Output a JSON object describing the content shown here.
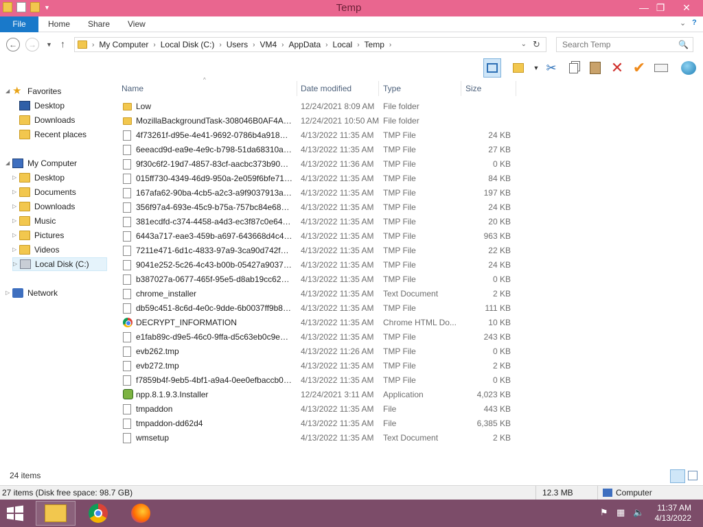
{
  "window": {
    "title": "Temp",
    "controls": {
      "minimize": "—",
      "maximize": "❐",
      "close": "✕"
    }
  },
  "ribbon": {
    "file_tab": "File",
    "tabs": [
      "Home",
      "Share",
      "View"
    ]
  },
  "address": {
    "breadcrumbs": [
      "My Computer",
      "Local Disk (C:)",
      "Users",
      "VM4",
      "AppData",
      "Local",
      "Temp"
    ]
  },
  "search": {
    "placeholder": "Search Temp"
  },
  "nav": {
    "favorites_header": "Favorites",
    "favorites": [
      "Desktop",
      "Downloads",
      "Recent places"
    ],
    "computer_header": "My Computer",
    "computer_items": [
      "Desktop",
      "Documents",
      "Downloads",
      "Music",
      "Pictures",
      "Videos",
      "Local Disk (C:)"
    ],
    "network": "Network"
  },
  "columns": {
    "name": "Name",
    "date": "Date modified",
    "type": "Type",
    "size": "Size"
  },
  "files": [
    {
      "icon": "folder",
      "name": "Low",
      "date": "12/24/2021 8:09 AM",
      "type": "File folder",
      "size": ""
    },
    {
      "icon": "folder",
      "name": "MozillaBackgroundTask-308046B0AF4A3...",
      "date": "12/24/2021 10:50 AM",
      "type": "File folder",
      "size": ""
    },
    {
      "icon": "doc",
      "name": "4f73261f-d95e-4e41-9692-0786b4a9181e.t...",
      "date": "4/13/2022 11:35 AM",
      "type": "TMP File",
      "size": "24 KB"
    },
    {
      "icon": "doc",
      "name": "6eeacd9d-ea9e-4e9c-b798-51da68310a9b...",
      "date": "4/13/2022 11:35 AM",
      "type": "TMP File",
      "size": "27 KB"
    },
    {
      "icon": "doc",
      "name": "9f30c6f2-19d7-4857-83cf-aacbc373b90c.t...",
      "date": "4/13/2022 11:36 AM",
      "type": "TMP File",
      "size": "0 KB"
    },
    {
      "icon": "doc",
      "name": "015ff730-4349-46d9-950a-2e059f6bfe71.t...",
      "date": "4/13/2022 11:35 AM",
      "type": "TMP File",
      "size": "84 KB"
    },
    {
      "icon": "doc",
      "name": "167afa62-90ba-4cb5-a2c3-a9f9037913af.t...",
      "date": "4/13/2022 11:35 AM",
      "type": "TMP File",
      "size": "197 KB"
    },
    {
      "icon": "doc",
      "name": "356f97a4-693e-45c9-b75a-757bc84e686e....",
      "date": "4/13/2022 11:35 AM",
      "type": "TMP File",
      "size": "24 KB"
    },
    {
      "icon": "doc",
      "name": "381ecdfd-c374-4458-a4d3-ec3f87c0e642....",
      "date": "4/13/2022 11:35 AM",
      "type": "TMP File",
      "size": "20 KB"
    },
    {
      "icon": "doc",
      "name": "6443a717-eae3-459b-a697-643668d4c4d2...",
      "date": "4/13/2022 11:35 AM",
      "type": "TMP File",
      "size": "963 KB"
    },
    {
      "icon": "doc",
      "name": "7211e471-6d1c-4833-97a9-3ca90d742f8d....",
      "date": "4/13/2022 11:35 AM",
      "type": "TMP File",
      "size": "22 KB"
    },
    {
      "icon": "doc",
      "name": "9041e252-5c26-4c43-b00b-05427a903759....",
      "date": "4/13/2022 11:35 AM",
      "type": "TMP File",
      "size": "24 KB"
    },
    {
      "icon": "doc",
      "name": "b387027a-0677-465f-95e5-d8ab19cc62ad....",
      "date": "4/13/2022 11:35 AM",
      "type": "TMP File",
      "size": "0 KB"
    },
    {
      "icon": "doc",
      "name": "chrome_installer",
      "date": "4/13/2022 11:35 AM",
      "type": "Text Document",
      "size": "2 KB"
    },
    {
      "icon": "doc",
      "name": "db59c451-8c6d-4e0c-9dde-6b0037ff9b88....",
      "date": "4/13/2022 11:35 AM",
      "type": "TMP File",
      "size": "111 KB"
    },
    {
      "icon": "chrome",
      "name": "DECRYPT_INFORMATION",
      "date": "4/13/2022 11:35 AM",
      "type": "Chrome HTML Do...",
      "size": "10 KB"
    },
    {
      "icon": "doc",
      "name": "e1fab89c-d9e5-46c0-9ffa-d5c63eb0c9ea.t...",
      "date": "4/13/2022 11:35 AM",
      "type": "TMP File",
      "size": "243 KB"
    },
    {
      "icon": "doc",
      "name": "evb262.tmp",
      "date": "4/13/2022 11:26 AM",
      "type": "TMP File",
      "size": "0 KB"
    },
    {
      "icon": "doc",
      "name": "evb272.tmp",
      "date": "4/13/2022 11:35 AM",
      "type": "TMP File",
      "size": "2 KB"
    },
    {
      "icon": "doc",
      "name": "f7859b4f-9eb5-4bf1-a9a4-0ee0efbaccb0.t...",
      "date": "4/13/2022 11:35 AM",
      "type": "TMP File",
      "size": "0 KB"
    },
    {
      "icon": "app",
      "name": "npp.8.1.9.3.Installer",
      "date": "12/24/2021 3:11 AM",
      "type": "Application",
      "size": "4,023 KB"
    },
    {
      "icon": "doc",
      "name": "tmpaddon",
      "date": "4/13/2022 11:35 AM",
      "type": "File",
      "size": "443 KB"
    },
    {
      "icon": "doc",
      "name": "tmpaddon-dd62d4",
      "date": "4/13/2022 11:35 AM",
      "type": "File",
      "size": "6,385 KB"
    },
    {
      "icon": "doc",
      "name": "wmsetup",
      "date": "4/13/2022 11:35 AM",
      "type": "Text Document",
      "size": "2 KB"
    }
  ],
  "item_count": "24 items",
  "status": {
    "left": "27 items (Disk free space: 98.7 GB)",
    "size": "12.3 MB",
    "location": "Computer"
  },
  "clock": {
    "time": "11:37 AM",
    "date": "4/13/2022"
  },
  "colors": {
    "titlebar": "#e9668f",
    "file_tab": "#1979ca",
    "taskbar": "#7c4c69"
  }
}
